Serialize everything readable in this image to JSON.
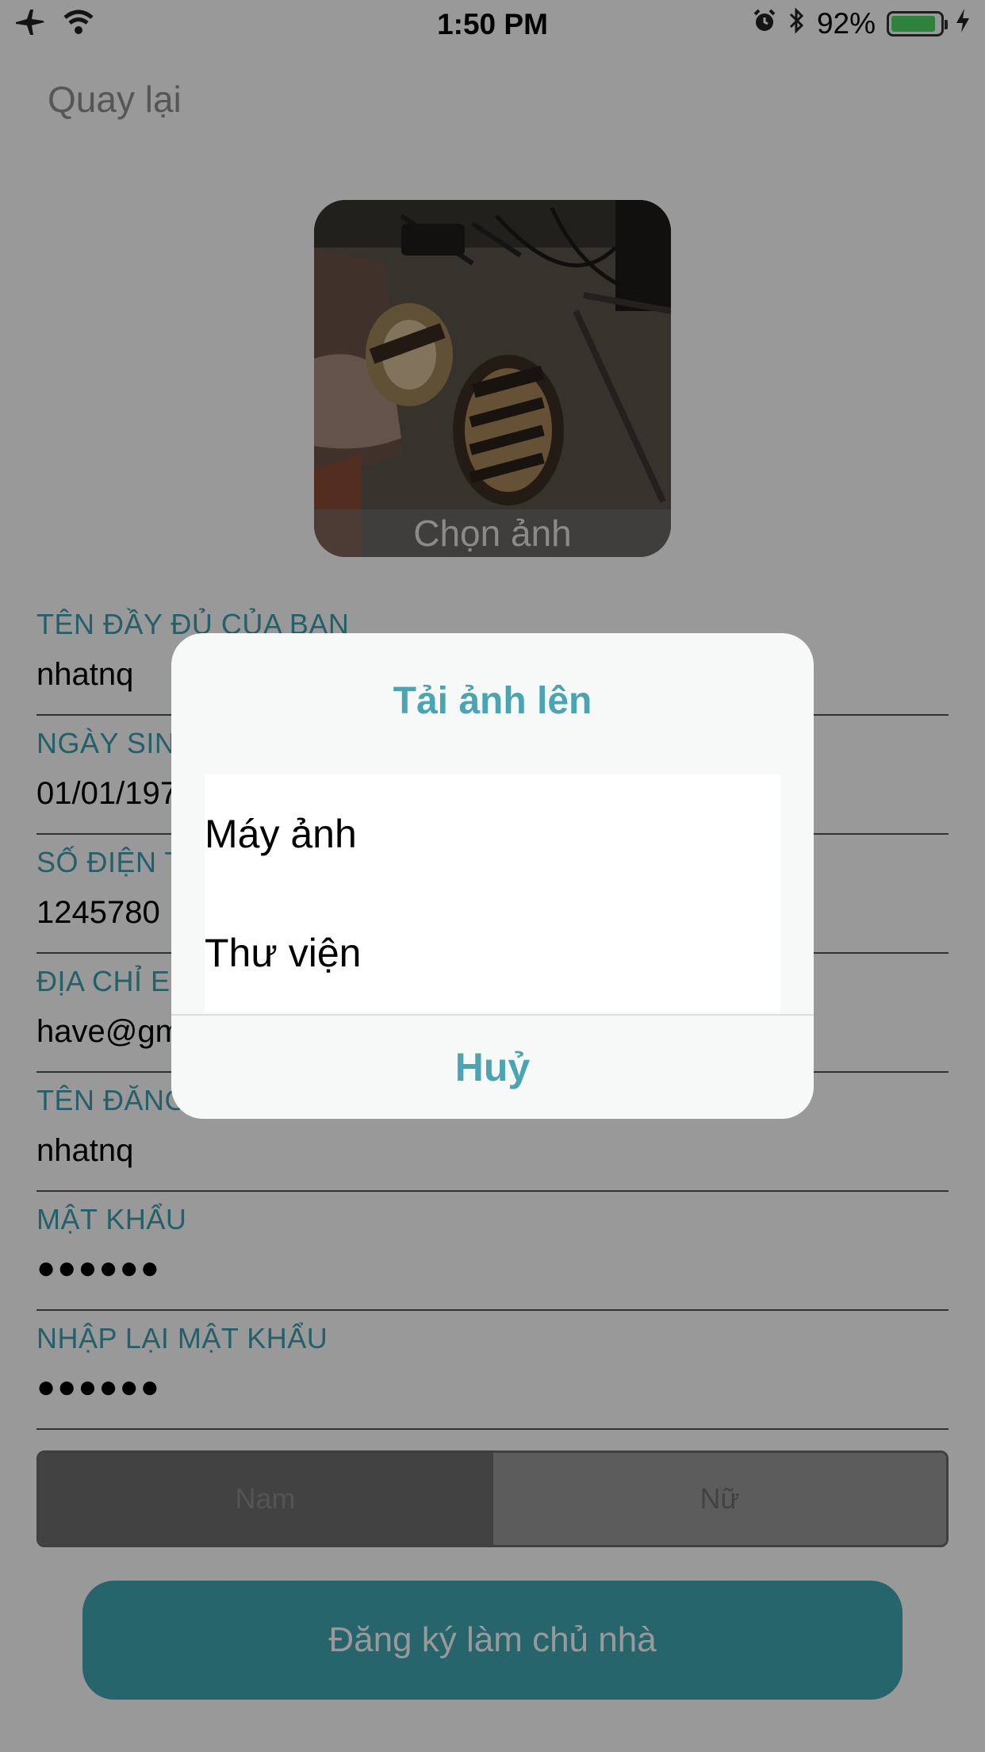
{
  "status_bar": {
    "time": "1:50 PM",
    "battery_text": "92%",
    "battery_level": 0.92,
    "icons": [
      "airplane-icon",
      "wifi-icon",
      "alarm-icon",
      "bluetooth-icon",
      "battery-icon",
      "charging-icon"
    ]
  },
  "nav": {
    "back_label": "Quay lại"
  },
  "avatar": {
    "choose_label": "Chọn ảnh"
  },
  "fields": [
    {
      "label": "TÊN ĐẦY ĐỦ CỦA BẠN",
      "value": "nhatnq"
    },
    {
      "label": "NGÀY SINH",
      "value": "01/01/197"
    },
    {
      "label": "SỐ ĐIỆN THOẠI",
      "value": "1245780"
    },
    {
      "label": "ĐỊA CHỈ EMAIL",
      "value": "have@gm"
    },
    {
      "label": "TÊN ĐĂNG NHẬP",
      "value": "nhatnq"
    },
    {
      "label": "MẬT KHẨU",
      "value": "●●●●●●"
    },
    {
      "label": "NHẬP LẠI MẬT KHẨU",
      "value": "●●●●●●"
    }
  ],
  "gender": {
    "male": "Nam",
    "female": "Nữ",
    "selected": "Nam"
  },
  "register_button": "Đăng ký làm chủ nhà",
  "action_sheet": {
    "title": "Tải ảnh lên",
    "options": [
      "Máy ảnh",
      "Thư viện"
    ],
    "cancel": "Huỷ"
  },
  "colors": {
    "accent": "#41a9b4",
    "label": "#3da0b0",
    "overlay": "rgba(0,0,0,0.4)"
  }
}
